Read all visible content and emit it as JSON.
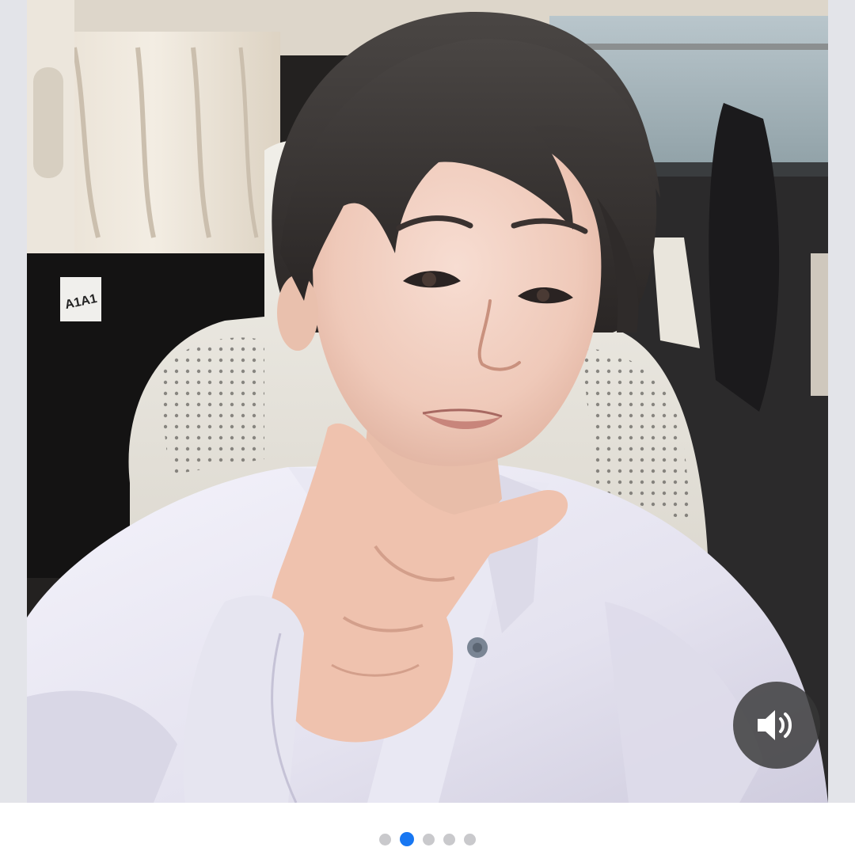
{
  "viewer": {
    "accent_color": "#1877f2",
    "inactive_dot_color": "#c9c9cc",
    "sound_button": {
      "icon": "speaker-on-icon",
      "state": "unmuted"
    },
    "pagination": {
      "total": 5,
      "active_index": 1
    },
    "photo": {
      "kind": "selfie",
      "vehicle_label": "A1A1"
    }
  }
}
